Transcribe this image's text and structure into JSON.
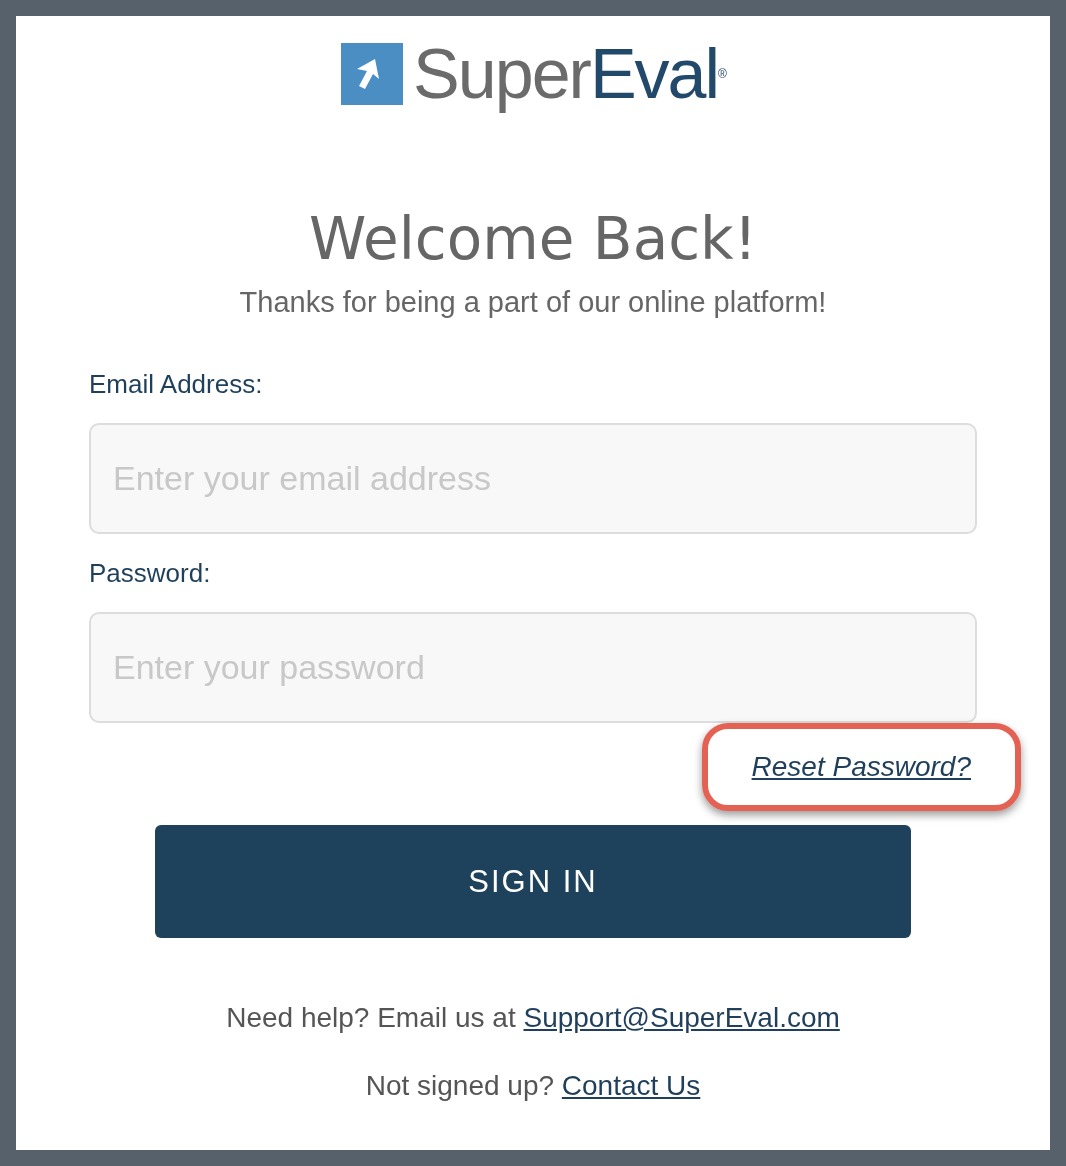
{
  "brand": {
    "first": "Super",
    "second": "Eval",
    "registered": "®"
  },
  "heading": "Welcome Back!",
  "subheading": "Thanks for being a part of our online platform!",
  "fields": [
    {
      "label": "Email Address:",
      "placeholder": "Enter your email address"
    },
    {
      "label": "Password:",
      "placeholder": "Enter your password"
    }
  ],
  "reset_link": {
    "text": "Reset Password?",
    "highlighted": true
  },
  "sign_in_button": "SIGN IN",
  "help": {
    "text": "Need help? Email us at",
    "link": "Support@SuperEval.com"
  },
  "signup": {
    "text": "Not signed up?",
    "link": "Contact Us"
  }
}
